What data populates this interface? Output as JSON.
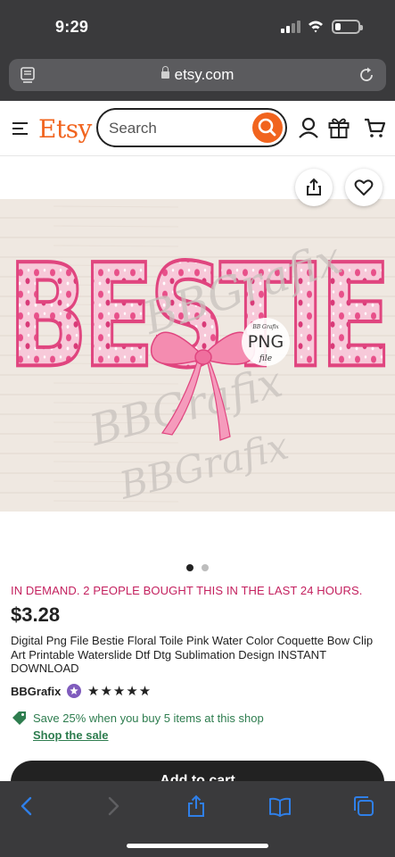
{
  "status_bar": {
    "time": "9:29"
  },
  "browser": {
    "url": "etsy.com"
  },
  "header": {
    "logo": "Etsy",
    "search_placeholder": "Search"
  },
  "product_image": {
    "main_word": "BESTIE",
    "badge_line1": "BB Grafix",
    "badge_line2": "PNG",
    "badge_line3": "file",
    "watermarks": [
      "BBGrafix",
      "BBGrafix",
      "BBGrafix"
    ],
    "image_count": 2,
    "active_index": 1
  },
  "listing": {
    "demand_text": "IN DEMAND. 2 PEOPLE BOUGHT THIS IN THE LAST 24 HOURS.",
    "price": "$3.28",
    "title": "Digital Png File Bestie Floral Toile Pink Water Color Coquette Bow Clip Art Printable Waterslide Dtf Dtg Sublimation Design INSTANT DOWNLOAD",
    "shop_name": "BBGrafix",
    "rating_stars": "★★★★★",
    "rating": 5,
    "promo_text": "Save 25% when you buy 5 items at this shop",
    "promo_link": "Shop the sale",
    "add_to_cart": "Add to cart"
  },
  "colors": {
    "etsy_orange": "#f1641e",
    "demand_pink": "#c4215f",
    "promo_green": "#2e7d4f",
    "bestie_pink": "#e8508a",
    "browser_dark": "#3a3a3c",
    "ios_blue": "#2f7fe8"
  },
  "icons": [
    "hamburger-icon",
    "search-icon",
    "account-icon",
    "gift-icon",
    "cart-icon",
    "share-icon",
    "heart-icon",
    "star-seller-icon",
    "tag-icon",
    "back-icon",
    "forward-icon",
    "bookmarks-icon",
    "tabs-icon"
  ]
}
